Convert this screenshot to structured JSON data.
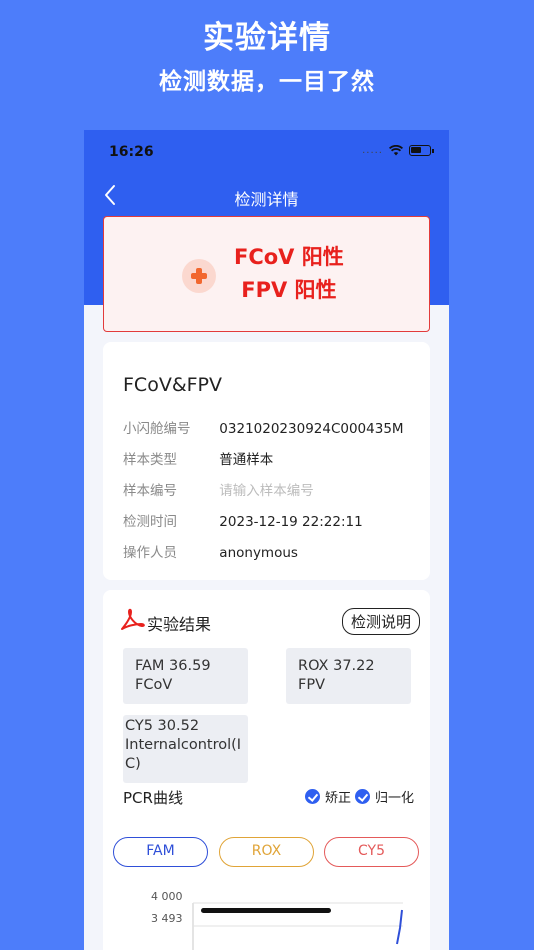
{
  "promo": {
    "title": "实验详情",
    "subtitle": "检测数据，一目了然"
  },
  "status_bar": {
    "time": "16:26",
    "signal_dots": "....."
  },
  "nav": {
    "title": "检测详情"
  },
  "result": {
    "line1": "FCoV 阳性",
    "line2": "FPV 阳性",
    "positive_color": "#e8211d"
  },
  "info": {
    "sample_name": "FCoV&FPV",
    "rows": [
      {
        "label": "小闪舱编号",
        "value": "0321020230924C000435M"
      },
      {
        "label": "样本类型",
        "value": "普通样本"
      },
      {
        "label": "样本编号",
        "placeholder": "请输入样本编号"
      },
      {
        "label": "检测时间",
        "value": "2023-12-19 22:22:11"
      },
      {
        "label": "操作人员",
        "value": "anonymous"
      }
    ]
  },
  "results": {
    "title": "实验结果",
    "help_label": "检测说明",
    "channels": [
      {
        "line1": "FAM 36.59",
        "line2": "FCoV"
      },
      {
        "line1": "ROX 37.22",
        "line2": "FPV"
      },
      {
        "line1": "CY5 30.52",
        "line2": "Internalcontrol(I",
        "line3": "C)"
      }
    ],
    "pcr_label": "PCR曲线",
    "options": [
      {
        "label": "矫正",
        "checked": true
      },
      {
        "label": "归一化",
        "checked": true
      }
    ],
    "tabs": [
      {
        "label": "FAM",
        "color": "#2f4fd8"
      },
      {
        "label": "ROX",
        "color": "#e0a437"
      },
      {
        "label": "CY5",
        "color": "#e45a5a"
      }
    ],
    "y_ticks": [
      "4 000",
      "3 493"
    ],
    "accent_color": "#2f5ff0"
  }
}
